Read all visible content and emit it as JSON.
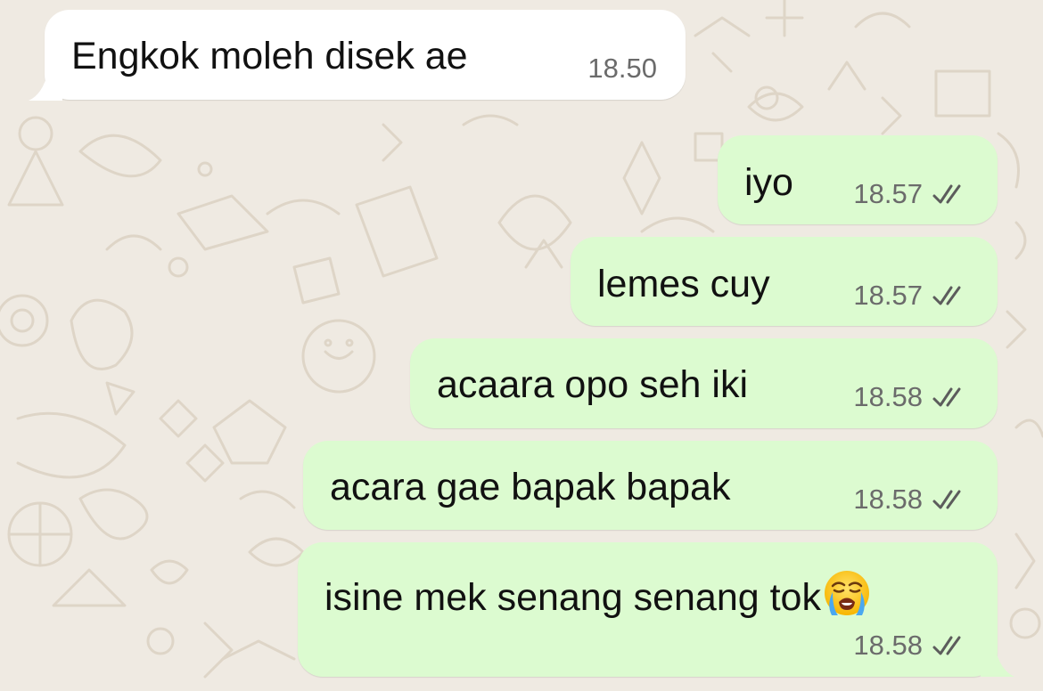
{
  "colors": {
    "background": "#efeae2",
    "incoming_bubble": "#ffffff",
    "outgoing_bubble": "#dcfbd0",
    "timestamp": "#6b6b6b",
    "read_ticks": "#5c5c5c"
  },
  "messages": [
    {
      "direction": "incoming",
      "text": "Engkok moleh disek ae",
      "time": "18.50"
    },
    {
      "direction": "outgoing",
      "text": "iyo",
      "time": "18.57",
      "status_icon": "double-check-icon"
    },
    {
      "direction": "outgoing",
      "text": "lemes cuy",
      "time": "18.57",
      "status_icon": "double-check-icon"
    },
    {
      "direction": "outgoing",
      "text": "acaara opo seh iki",
      "time": "18.58",
      "status_icon": "double-check-icon"
    },
    {
      "direction": "outgoing",
      "text": "acara gae bapak bapak",
      "time": "18.58",
      "status_icon": "double-check-icon"
    },
    {
      "direction": "outgoing",
      "text": "isine mek senang senang tok",
      "time": "18.58",
      "status_icon": "double-check-icon",
      "emoji": "loudly-crying-face-icon"
    }
  ]
}
